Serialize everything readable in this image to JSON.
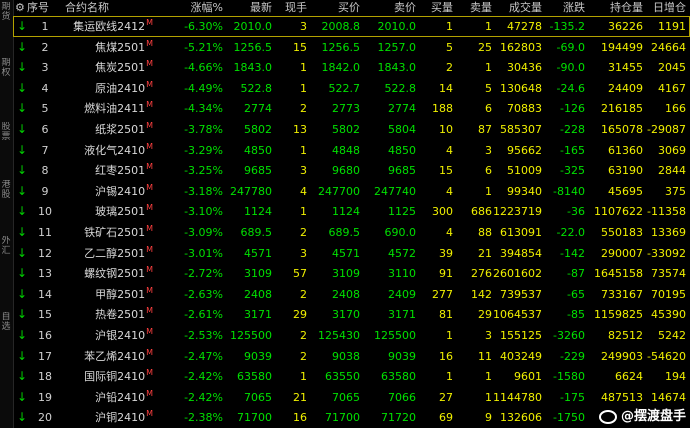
{
  "side_tabs": [
    "期货",
    "期权",
    "股票",
    "港股",
    "外汇",
    "自选"
  ],
  "header": {
    "seq": "序号",
    "name": "合约名称",
    "change_pct": "涨幅%",
    "last": "最新",
    "vol_now": "现手",
    "bid": "买价",
    "ask": "卖价",
    "bid_vol": "买量",
    "ask_vol": "卖量",
    "volume": "成交量",
    "change": "涨跌",
    "open_interest": "持仓量",
    "daily_oi": "日增仓"
  },
  "rows": [
    {
      "idx": "1",
      "name": "集运欧线2412",
      "pct": "-6.30%",
      "last": "2010.0",
      "now": "3",
      "bid": "2008.8",
      "ask": "2010.0",
      "bv": "1",
      "av": "1",
      "vol": "47278",
      "chg": "-135.2",
      "oi": "36226",
      "doi": "1191"
    },
    {
      "idx": "2",
      "name": "焦煤2501",
      "pct": "-5.21%",
      "last": "1256.5",
      "now": "15",
      "bid": "1256.5",
      "ask": "1257.0",
      "bv": "5",
      "av": "25",
      "vol": "162803",
      "chg": "-69.0",
      "oi": "194499",
      "doi": "24664"
    },
    {
      "idx": "3",
      "name": "焦炭2501",
      "pct": "-4.66%",
      "last": "1843.0",
      "now": "1",
      "bid": "1842.0",
      "ask": "1843.0",
      "bv": "2",
      "av": "1",
      "vol": "30436",
      "chg": "-90.0",
      "oi": "31455",
      "doi": "2045"
    },
    {
      "idx": "4",
      "name": "原油2410",
      "pct": "-4.49%",
      "last": "522.8",
      "now": "1",
      "bid": "522.7",
      "ask": "522.8",
      "bv": "14",
      "av": "5",
      "vol": "130648",
      "chg": "-24.6",
      "oi": "24409",
      "doi": "4167"
    },
    {
      "idx": "5",
      "name": "燃料油2411",
      "pct": "-4.34%",
      "last": "2774",
      "now": "2",
      "bid": "2773",
      "ask": "2774",
      "bv": "188",
      "av": "6",
      "vol": "70883",
      "chg": "-126",
      "oi": "216185",
      "doi": "166"
    },
    {
      "idx": "6",
      "name": "纸浆2501",
      "pct": "-3.78%",
      "last": "5802",
      "now": "13",
      "bid": "5802",
      "ask": "5804",
      "bv": "10",
      "av": "87",
      "vol": "585307",
      "chg": "-228",
      "oi": "165078",
      "doi": "-29087"
    },
    {
      "idx": "7",
      "name": "液化气2410",
      "pct": "-3.29%",
      "last": "4850",
      "now": "1",
      "bid": "4848",
      "ask": "4850",
      "bv": "4",
      "av": "3",
      "vol": "95662",
      "chg": "-165",
      "oi": "61360",
      "doi": "3069"
    },
    {
      "idx": "8",
      "name": "红枣2501",
      "pct": "-3.25%",
      "last": "9685",
      "now": "3",
      "bid": "9680",
      "ask": "9685",
      "bv": "15",
      "av": "6",
      "vol": "51009",
      "chg": "-325",
      "oi": "63190",
      "doi": "2844"
    },
    {
      "idx": "9",
      "name": "沪锡2410",
      "pct": "-3.18%",
      "last": "247780",
      "now": "4",
      "bid": "247700",
      "ask": "247740",
      "bv": "4",
      "av": "1",
      "vol": "99340",
      "chg": "-8140",
      "oi": "45695",
      "doi": "375"
    },
    {
      "idx": "10",
      "name": "玻璃2501",
      "pct": "-3.10%",
      "last": "1124",
      "now": "1",
      "bid": "1124",
      "ask": "1125",
      "bv": "300",
      "av": "686",
      "vol": "1223719",
      "chg": "-36",
      "oi": "1107622",
      "doi": "-11358"
    },
    {
      "idx": "11",
      "name": "铁矿石2501",
      "pct": "-3.09%",
      "last": "689.5",
      "now": "2",
      "bid": "689.5",
      "ask": "690.0",
      "bv": "4",
      "av": "88",
      "vol": "613091",
      "chg": "-22.0",
      "oi": "550183",
      "doi": "13369"
    },
    {
      "idx": "12",
      "name": "乙二醇2501",
      "pct": "-3.01%",
      "last": "4571",
      "now": "3",
      "bid": "4571",
      "ask": "4572",
      "bv": "39",
      "av": "21",
      "vol": "394854",
      "chg": "-142",
      "oi": "290007",
      "doi": "-33092"
    },
    {
      "idx": "13",
      "name": "螺纹钢2501",
      "pct": "-2.72%",
      "last": "3109",
      "now": "57",
      "bid": "3109",
      "ask": "3110",
      "bv": "91",
      "av": "276",
      "vol": "2601602",
      "chg": "-87",
      "oi": "1645158",
      "doi": "73574"
    },
    {
      "idx": "14",
      "name": "甲醇2501",
      "pct": "-2.63%",
      "last": "2408",
      "now": "2",
      "bid": "2408",
      "ask": "2409",
      "bv": "277",
      "av": "142",
      "vol": "739537",
      "chg": "-65",
      "oi": "733167",
      "doi": "70195"
    },
    {
      "idx": "15",
      "name": "热卷2501",
      "pct": "-2.61%",
      "last": "3171",
      "now": "29",
      "bid": "3170",
      "ask": "3171",
      "bv": "81",
      "av": "29",
      "vol": "1064537",
      "chg": "-85",
      "oi": "1159825",
      "doi": "45390"
    },
    {
      "idx": "16",
      "name": "沪银2410",
      "pct": "-2.53%",
      "last": "125500",
      "now": "2",
      "bid": "125430",
      "ask": "125500",
      "bv": "1",
      "av": "3",
      "vol": "155125",
      "chg": "-3260",
      "oi": "82512",
      "doi": "5242"
    },
    {
      "idx": "17",
      "name": "苯乙烯2410",
      "pct": "-2.47%",
      "last": "9039",
      "now": "2",
      "bid": "9038",
      "ask": "9039",
      "bv": "16",
      "av": "11",
      "vol": "403249",
      "chg": "-229",
      "oi": "249903",
      "doi": "-54620"
    },
    {
      "idx": "18",
      "name": "国际铜2410",
      "pct": "-2.42%",
      "last": "63580",
      "now": "1",
      "bid": "63550",
      "ask": "63580",
      "bv": "1",
      "av": "1",
      "vol": "9601",
      "chg": "-1580",
      "oi": "6624",
      "doi": "194"
    },
    {
      "idx": "19",
      "name": "沪铅2410",
      "pct": "-2.42%",
      "last": "7065",
      "now": "21",
      "bid": "7065",
      "ask": "7066",
      "bv": "27",
      "av": "1",
      "vol": "1144780",
      "chg": "-175",
      "oi": "487513",
      "doi": "14674"
    },
    {
      "idx": "20",
      "name": "沪铜2410",
      "pct": "-2.38%",
      "last": "71700",
      "now": "16",
      "bid": "71700",
      "ask": "71720",
      "bv": "69",
      "av": "9",
      "vol": "132606",
      "chg": "-1750",
      "oi": "",
      "doi": ""
    }
  ],
  "contract_marker": "M",
  "row_arrow": "↓",
  "watermark": "@摆渡盘手",
  "colors": {
    "down": "#00e000",
    "yellow": "#f0f000",
    "marker": "#ff4040",
    "selection": "#b3a200"
  }
}
